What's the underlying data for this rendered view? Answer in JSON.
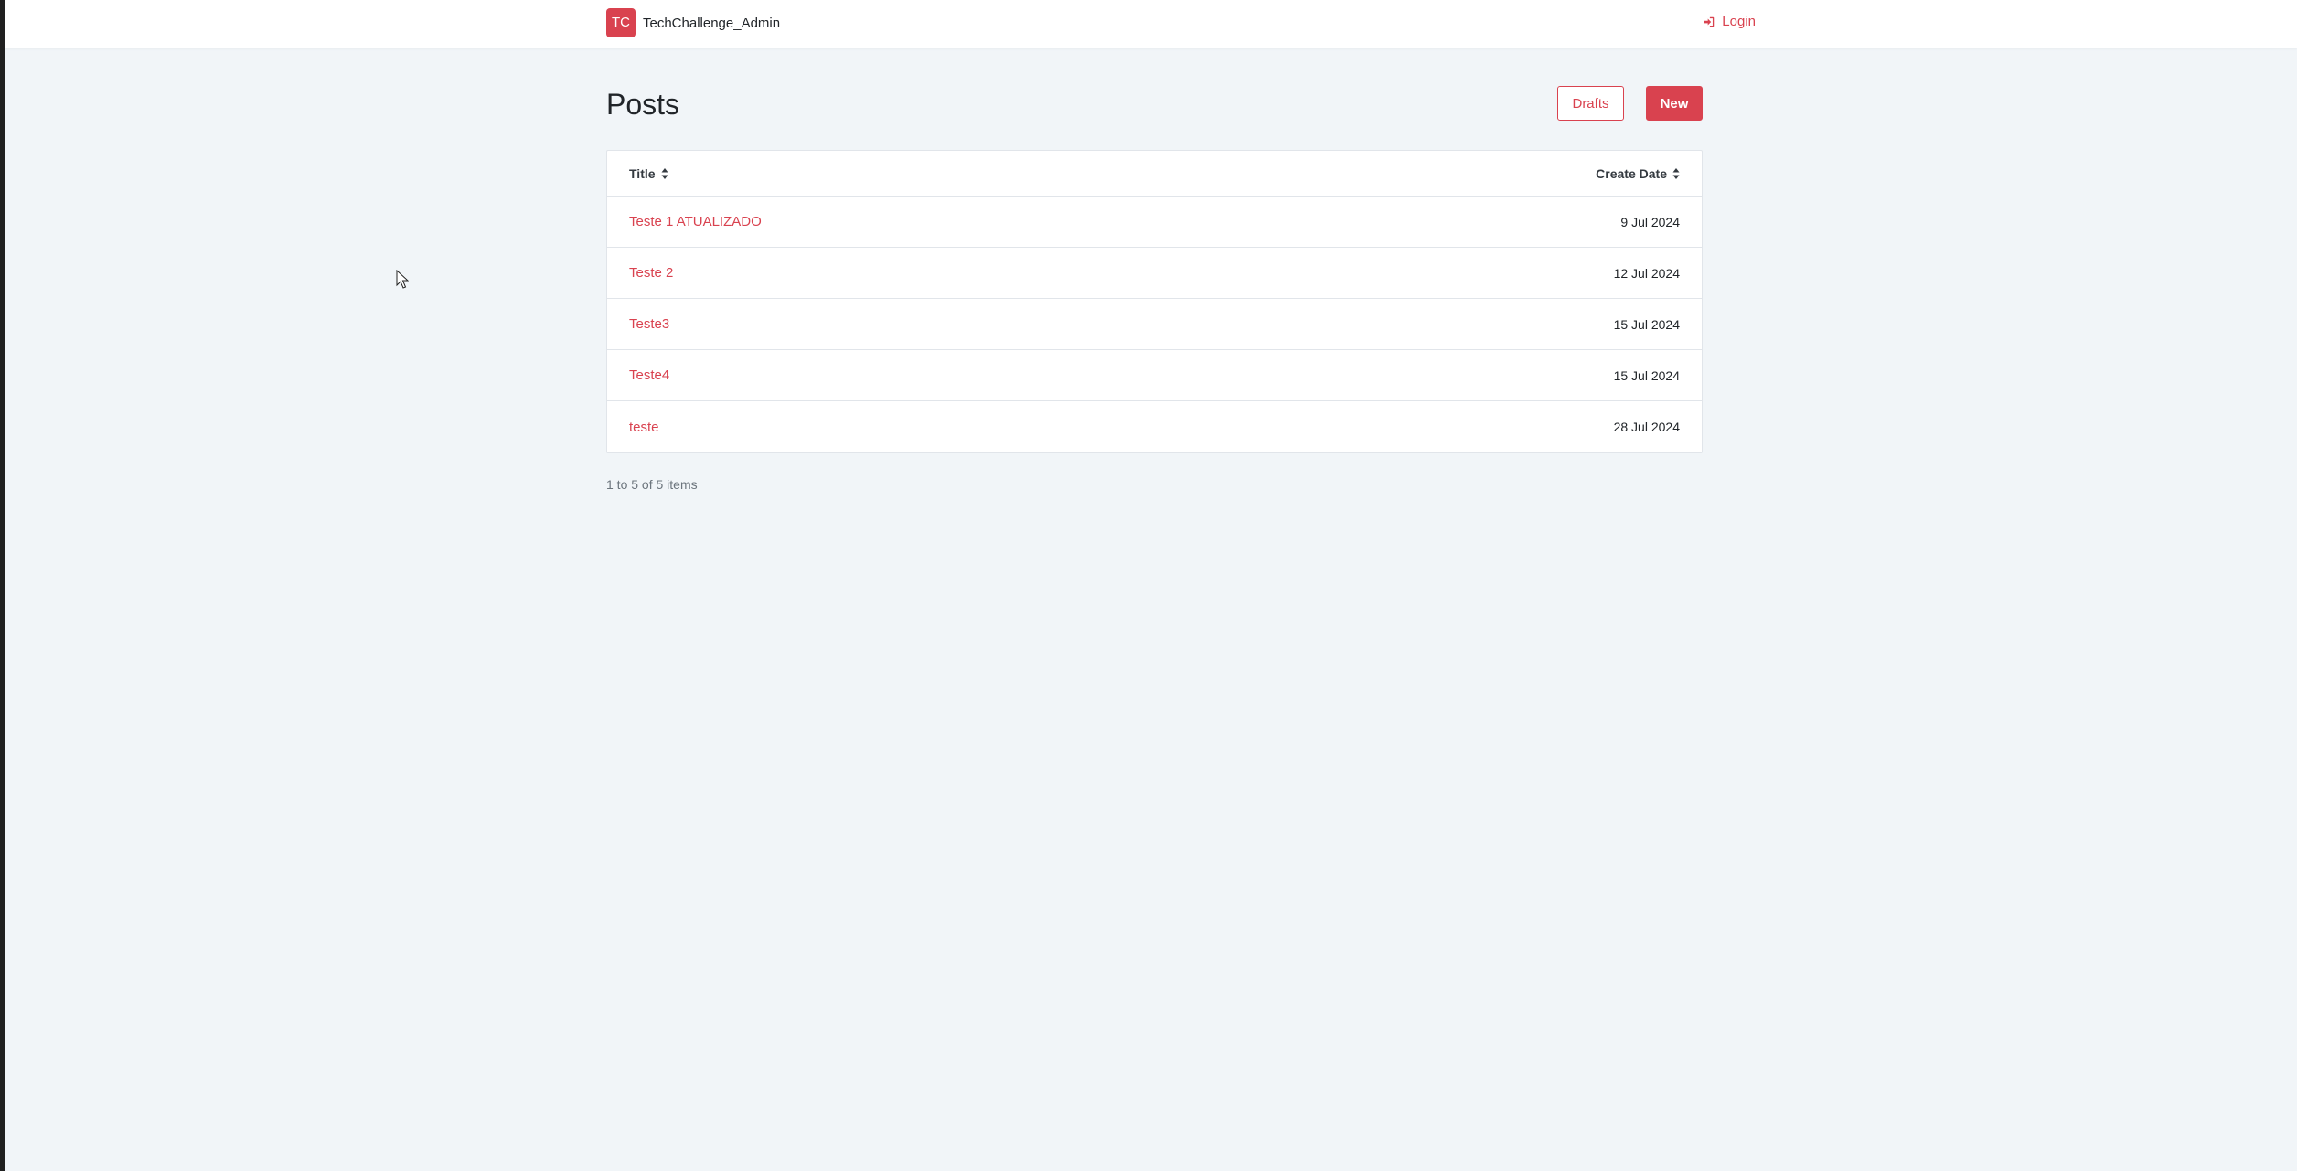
{
  "brand": {
    "logo_text": "TC",
    "name": "TechChallenge_Admin"
  },
  "nav": {
    "login_label": "Login",
    "login_icon": "sign-in-icon"
  },
  "page": {
    "title": "Posts"
  },
  "actions": {
    "drafts_label": "Drafts",
    "new_label": "New"
  },
  "table": {
    "columns": [
      {
        "label": "Title",
        "icon": "sort-icon"
      },
      {
        "label": "Create Date",
        "icon": "sort-icon"
      }
    ],
    "rows": [
      {
        "title": "Teste 1 ATUALIZADO",
        "date": "9 Jul 2024"
      },
      {
        "title": "Teste 2",
        "date": "12 Jul 2024"
      },
      {
        "title": "Teste3",
        "date": "15 Jul 2024"
      },
      {
        "title": "Teste4",
        "date": "15 Jul 2024"
      },
      {
        "title": "teste",
        "date": "28 Jul 2024"
      }
    ]
  },
  "pagination": {
    "info": "1 to 5 of 5 items"
  },
  "colors": {
    "accent": "#d9424f",
    "background": "#f1f5f8",
    "border": "#e1e5ea"
  }
}
